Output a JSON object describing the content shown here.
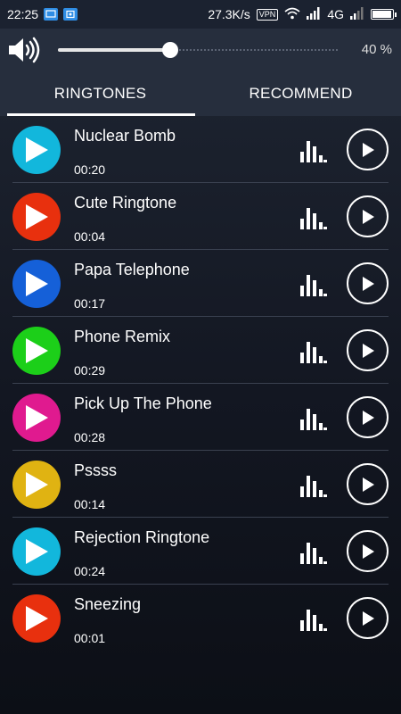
{
  "status_bar": {
    "time": "22:25",
    "network_speed": "27.3K/s",
    "vpn_label": "VPN",
    "network_type": "4G",
    "battery_level": 0.95
  },
  "volume": {
    "value_label": "40 %",
    "level": 0.4,
    "speaker_icon": "speaker-icon"
  },
  "tabs": [
    {
      "label": "RINGTONES",
      "active": true
    },
    {
      "label": "RECOMMEND",
      "active": false
    }
  ],
  "ringtones": [
    {
      "title": "Nuclear Bomb",
      "duration": "00:20",
      "color": "#12b7dc"
    },
    {
      "title": "Cute Ringtone",
      "duration": "00:04",
      "color": "#e8300e"
    },
    {
      "title": "Papa Telephone",
      "duration": "00:17",
      "color": "#1560d8"
    },
    {
      "title": "Phone Remix",
      "duration": "00:29",
      "color": "#1ccf19"
    },
    {
      "title": "Pick Up The Phone",
      "duration": "00:28",
      "color": "#e01a8f"
    },
    {
      "title": "Pssss",
      "duration": "00:14",
      "color": "#e0b312"
    },
    {
      "title": "Rejection Ringtone",
      "duration": "00:24",
      "color": "#12b7dc"
    },
    {
      "title": "Sneezing",
      "duration": "00:01",
      "color": "#e8300e"
    }
  ],
  "icons": {
    "thumb": "play-triangle-icon",
    "equalizer": "equalizer-icon",
    "play": "play-circle-icon"
  }
}
